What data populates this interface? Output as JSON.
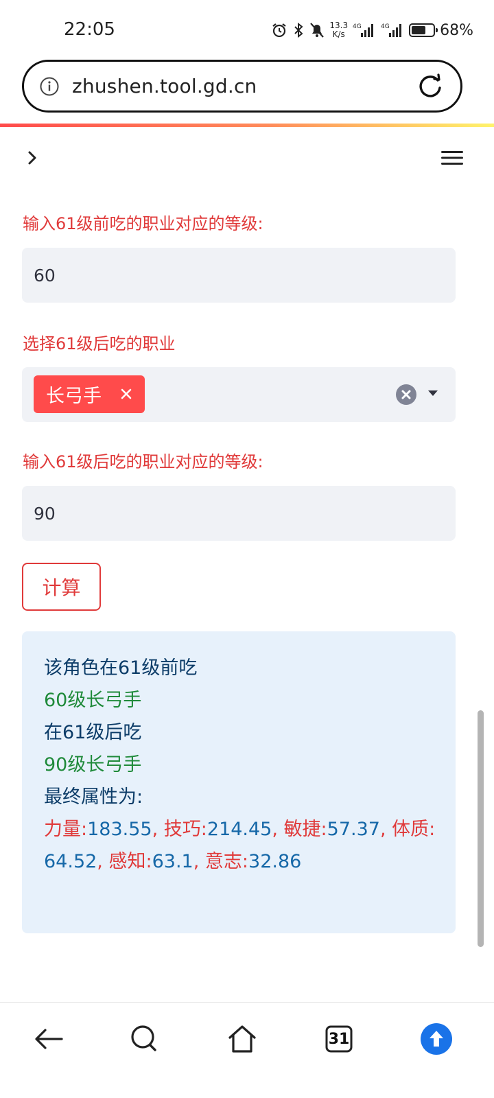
{
  "status_bar": {
    "time": "22:05",
    "net_speed_value": "13.3",
    "net_speed_unit": "K/s",
    "signal_1_label": "4G",
    "signal_2_label": "4G",
    "battery_percent_text": "68%",
    "battery_level": 0.68
  },
  "browser": {
    "url": "zhushen.tool.gd.cn",
    "tabs_count": "31"
  },
  "form": {
    "level_before_label": "输入61级前吃的职业对应的等级:",
    "level_before_value": "60",
    "class_after_label": "选择61级后吃的职业",
    "selected_class": "长弓手",
    "level_after_label": "输入61级后吃的职业对应的等级:",
    "level_after_value": "90",
    "calculate_label": "计算"
  },
  "result": {
    "line1": "该角色在61级前吃",
    "line2": "60级长弓手",
    "line3": "在61级后吃",
    "line4": "90级长弓手",
    "line5": "最终属性为:",
    "stats": [
      {
        "name": "力量:",
        "value": "183.55",
        "sep": ","
      },
      {
        "name": "技巧:",
        "value": "214.45",
        "sep": ","
      },
      {
        "name": "敏捷:",
        "value": "57.37",
        "sep": ","
      },
      {
        "name": "体质:",
        "value": "64.52",
        "sep": ","
      },
      {
        "name": "感知:",
        "value": "63.1",
        "sep": ","
      },
      {
        "name": "意志:",
        "value": "32.86",
        "sep": ""
      }
    ]
  },
  "colors": {
    "accent": "#ff4b4b",
    "label_red": "#e03a3a",
    "result_bg": "#e7f1fb",
    "navy_text": "#0c3c68",
    "green_text": "#1f8a3a",
    "blue_value": "#1668a8",
    "home_button_blue": "#1a73e8"
  }
}
